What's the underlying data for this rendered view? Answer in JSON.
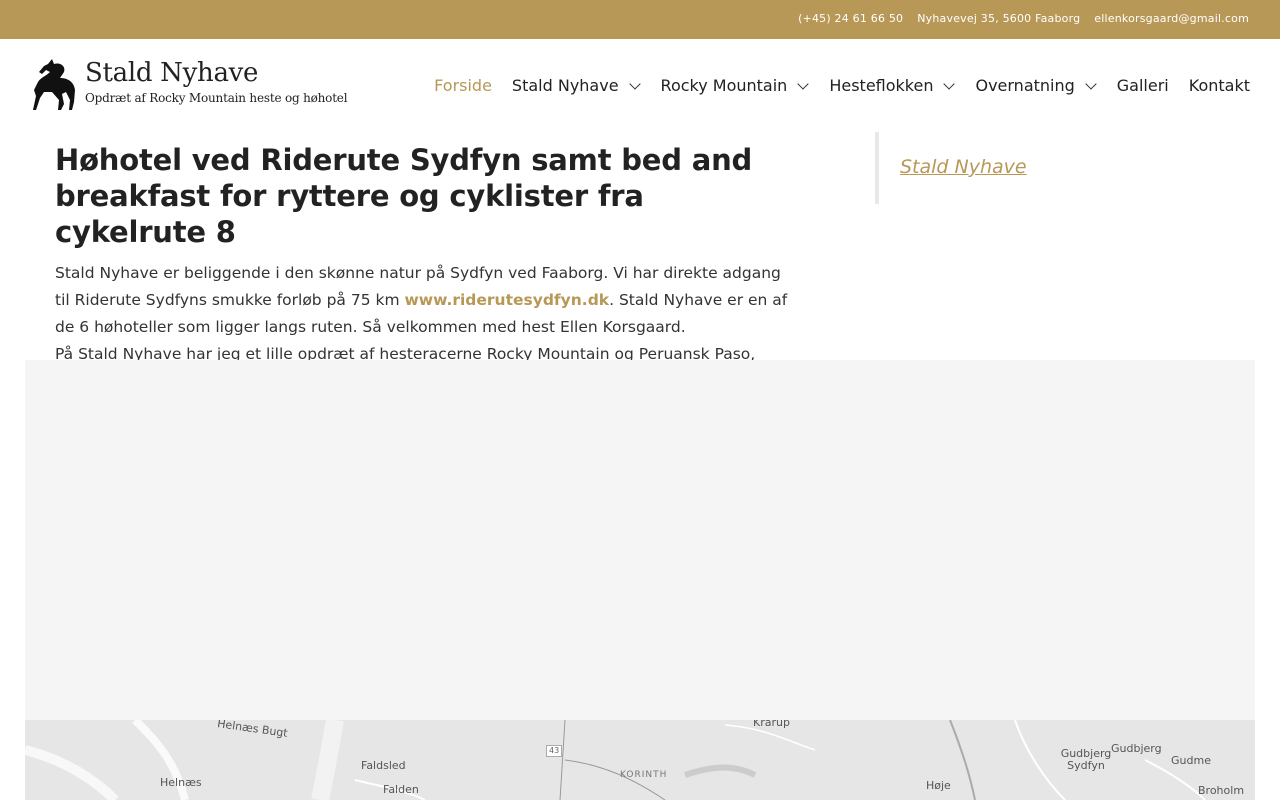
{
  "topbar": {
    "phone": "(+45) 24 61 66 50",
    "address": "Nyhavevej 35, 5600 Faaborg",
    "email": "ellenkorsgaard@gmail.com"
  },
  "logo": {
    "name": "Stald Nyhave",
    "tagline": "Opdræt af Rocky Mountain heste og høhotel"
  },
  "nav": {
    "items": [
      {
        "label": "Forside",
        "active": true,
        "dropdown": false
      },
      {
        "label": "Stald Nyhave",
        "dropdown": true
      },
      {
        "label": "Rocky Mountain",
        "dropdown": true
      },
      {
        "label": "Hesteflokken",
        "dropdown": true
      },
      {
        "label": "Overnatning",
        "dropdown": true
      },
      {
        "label": "Galleri",
        "dropdown": false
      },
      {
        "label": "Kontakt",
        "dropdown": false
      }
    ]
  },
  "main": {
    "heading": "Høhotel ved Riderute Sydfyn samt bed and breakfast for ryttere og cyklister fra cykelrute 8",
    "p1_before": "Stald Nyhave er beliggende i den skønne natur på Sydfyn ved Faaborg. Vi har direkte adgang til Riderute Sydfyns smukke forløb på 75 km ",
    "p1_link": "www.riderutesydfyn.dk",
    "p1_after": ". Stald Nyhave er en af de 6 høhoteller som ligger langs ruten. Så velkommen med hest Ellen Korsgaard.",
    "p2": "På Stald Nyhave har jeg et lille opdræt af hesteracerne Rocky Mountain og Peruansk Paso, begge racer er gangartsheste dvs. at de ”tølter” ligesom den Islandske hest."
  },
  "sidebar": {
    "link": "Stald Nyhave"
  },
  "map": {
    "labels": [
      "Helnæs Bugt",
      "Helnæs",
      "Faldsled",
      "Falden",
      "KORINTH",
      "Krarup",
      "Høje",
      "Gudbjerg Sydfyn",
      "Gudbjerg",
      "Gudme",
      "Broholm"
    ],
    "road": "43"
  },
  "colors": {
    "accent": "#b89856",
    "text": "#222222"
  }
}
